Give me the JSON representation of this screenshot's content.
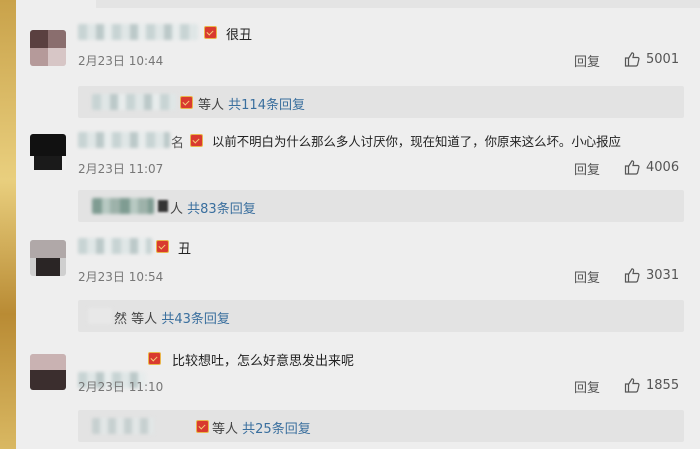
{
  "comments": [
    {
      "name_suffix": "",
      "text": "很丑",
      "time": "2月23日 10:44",
      "reply_label": "回复",
      "likes": "5001",
      "replies_prefix": "",
      "replies_mid": "等人",
      "replies_count": "共114条回复"
    },
    {
      "name_suffix": "名",
      "text": "以前不明白为什么那么多人讨厌你，现在知道了，你原来这么坏。小心报应",
      "time": "2月23日 11:07",
      "reply_label": "回复",
      "likes": "4006",
      "replies_prefix": "人",
      "replies_mid": "",
      "replies_count": "共83条回复"
    },
    {
      "name_suffix": "",
      "text": "丑",
      "time": "2月23日 10:54",
      "reply_label": "回复",
      "likes": "3031",
      "replies_prefix": "然",
      "replies_mid": "等人",
      "replies_count": "共43条回复"
    },
    {
      "name_suffix": "",
      "text": "比较想吐，怎么好意思发出来呢",
      "time": "2月23日 11:10",
      "reply_label": "回复",
      "likes": "1855",
      "replies_prefix": "",
      "replies_mid": "等人",
      "replies_count": "共25条回复"
    }
  ],
  "icons": {
    "like": "thumbs-up-icon",
    "badge": "vip-badge-icon"
  },
  "colors": {
    "link": "#3a6f9e",
    "badge": "#d93a2f"
  }
}
